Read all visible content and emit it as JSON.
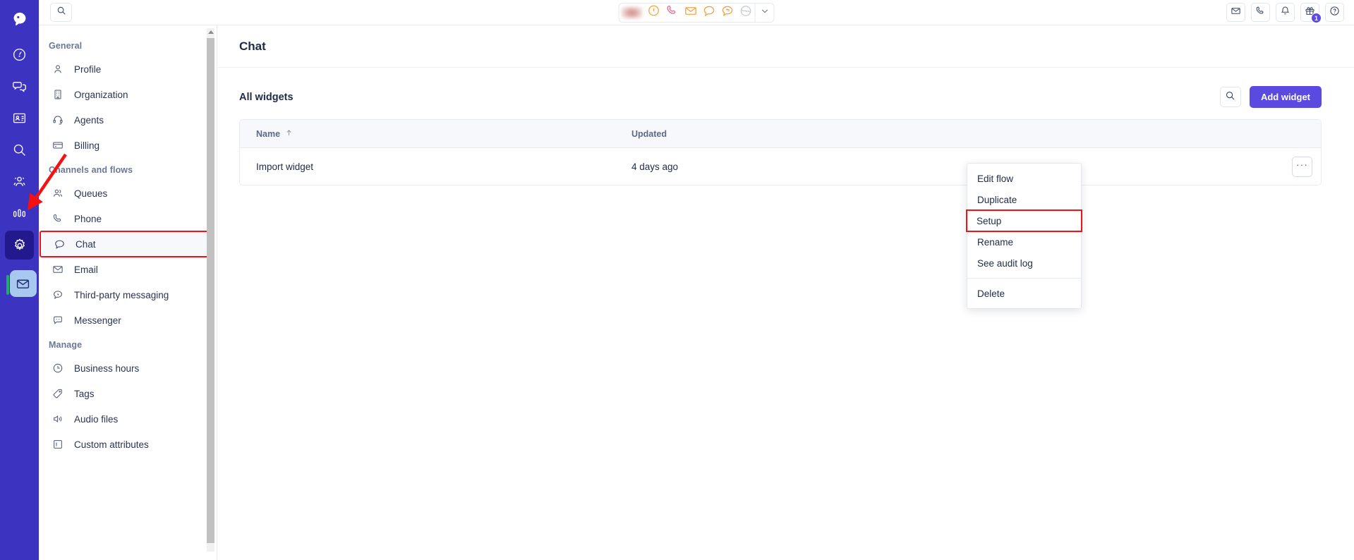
{
  "app": {
    "rail": {
      "items": [
        {
          "name": "logo",
          "icon": "chat-bubble-logo"
        },
        {
          "name": "dashboard",
          "icon": "gauge-icon"
        },
        {
          "name": "conversations",
          "icon": "chat-bubbles-icon"
        },
        {
          "name": "contacts",
          "icon": "contact-card-icon"
        },
        {
          "name": "search",
          "icon": "search-icon"
        },
        {
          "name": "teams",
          "icon": "people-icon"
        },
        {
          "name": "reports",
          "icon": "bar-chart-icon"
        },
        {
          "name": "settings",
          "icon": "gear-icon"
        }
      ],
      "bottom": {
        "name": "email",
        "icon": "envelope-icon"
      }
    },
    "topbar": {
      "search_placeholder": "Search",
      "search_icon": "search-icon",
      "status_cluster": {
        "redacted_label": "",
        "items": [
          {
            "name": "availability",
            "icon": "circle-exclamation-icon"
          },
          {
            "name": "phone",
            "icon": "phone-icon"
          },
          {
            "name": "email",
            "icon": "envelope-icon"
          },
          {
            "name": "chat",
            "icon": "chat-bubble-icon"
          },
          {
            "name": "messaging",
            "icon": "chat-reply-icon"
          },
          {
            "name": "other",
            "icon": "globe-icon"
          }
        ],
        "caret_icon": "chevron-down-icon"
      },
      "right_icons": [
        {
          "name": "email",
          "icon": "envelope-icon",
          "badge": ""
        },
        {
          "name": "phone",
          "icon": "phone-icon",
          "badge": ""
        },
        {
          "name": "notifications",
          "icon": "bell-icon",
          "badge": ""
        },
        {
          "name": "whats-new",
          "icon": "gift-icon",
          "badge": "1"
        },
        {
          "name": "help",
          "icon": "help-circle-icon",
          "badge": ""
        }
      ]
    },
    "settings_sidebar": {
      "groups": [
        {
          "title": "General",
          "items": [
            {
              "label": "Profile",
              "icon": "person-icon",
              "selected": false
            },
            {
              "label": "Organization",
              "icon": "building-icon",
              "selected": false
            },
            {
              "label": "Agents",
              "icon": "headset-icon",
              "selected": false
            },
            {
              "label": "Billing",
              "icon": "credit-card-icon",
              "selected": false
            }
          ]
        },
        {
          "title": "Channels and flows",
          "items": [
            {
              "label": "Queues",
              "icon": "people-icon",
              "selected": false
            },
            {
              "label": "Phone",
              "icon": "phone-icon",
              "selected": false
            },
            {
              "label": "Chat",
              "icon": "chat-bubble-icon",
              "selected": true
            },
            {
              "label": "Email",
              "icon": "envelope-icon",
              "selected": false
            },
            {
              "label": "Third-party messaging",
              "icon": "chat-dots-icon",
              "selected": false
            },
            {
              "label": "Messenger",
              "icon": "messenger-icon",
              "selected": false
            }
          ]
        },
        {
          "title": "Manage",
          "items": [
            {
              "label": "Business hours",
              "icon": "clock-icon",
              "selected": false
            },
            {
              "label": "Tags",
              "icon": "tag-icon",
              "selected": false
            },
            {
              "label": "Audio files",
              "icon": "speaker-icon",
              "selected": false
            },
            {
              "label": "Custom attributes",
              "icon": "square-bar-icon",
              "selected": false
            }
          ]
        }
      ]
    },
    "main": {
      "page_title": "Chat",
      "section_title": "All widgets",
      "search_icon": "search-icon",
      "add_button_label": "Add widget",
      "table": {
        "columns": [
          {
            "label": "Name",
            "sort_icon": "arrow-up-icon"
          },
          {
            "label": "Updated",
            "sort_icon": ""
          }
        ],
        "rows": [
          {
            "name": "Import widget",
            "updated": "4 days ago",
            "actions_label": "···"
          }
        ]
      }
    },
    "context_menu": {
      "items": [
        {
          "label": "Edit flow",
          "highlight": false
        },
        {
          "label": "Duplicate",
          "highlight": false
        },
        {
          "label": "Setup",
          "highlight": true
        },
        {
          "label": "Rename",
          "highlight": false
        },
        {
          "label": "See audit log",
          "highlight": false
        },
        {
          "separator": true
        },
        {
          "label": "Delete",
          "highlight": false
        }
      ]
    },
    "colors": {
      "rail_bg": "#3c33c0",
      "rail_active": "#221a8c",
      "accent": "#5b4ae0",
      "annotation_red": "#f51111",
      "status_green": "#22a96b",
      "status_orange": "#f2a33c",
      "status_pink": "#ec5f8e",
      "text_dark": "#1f2a44"
    }
  }
}
